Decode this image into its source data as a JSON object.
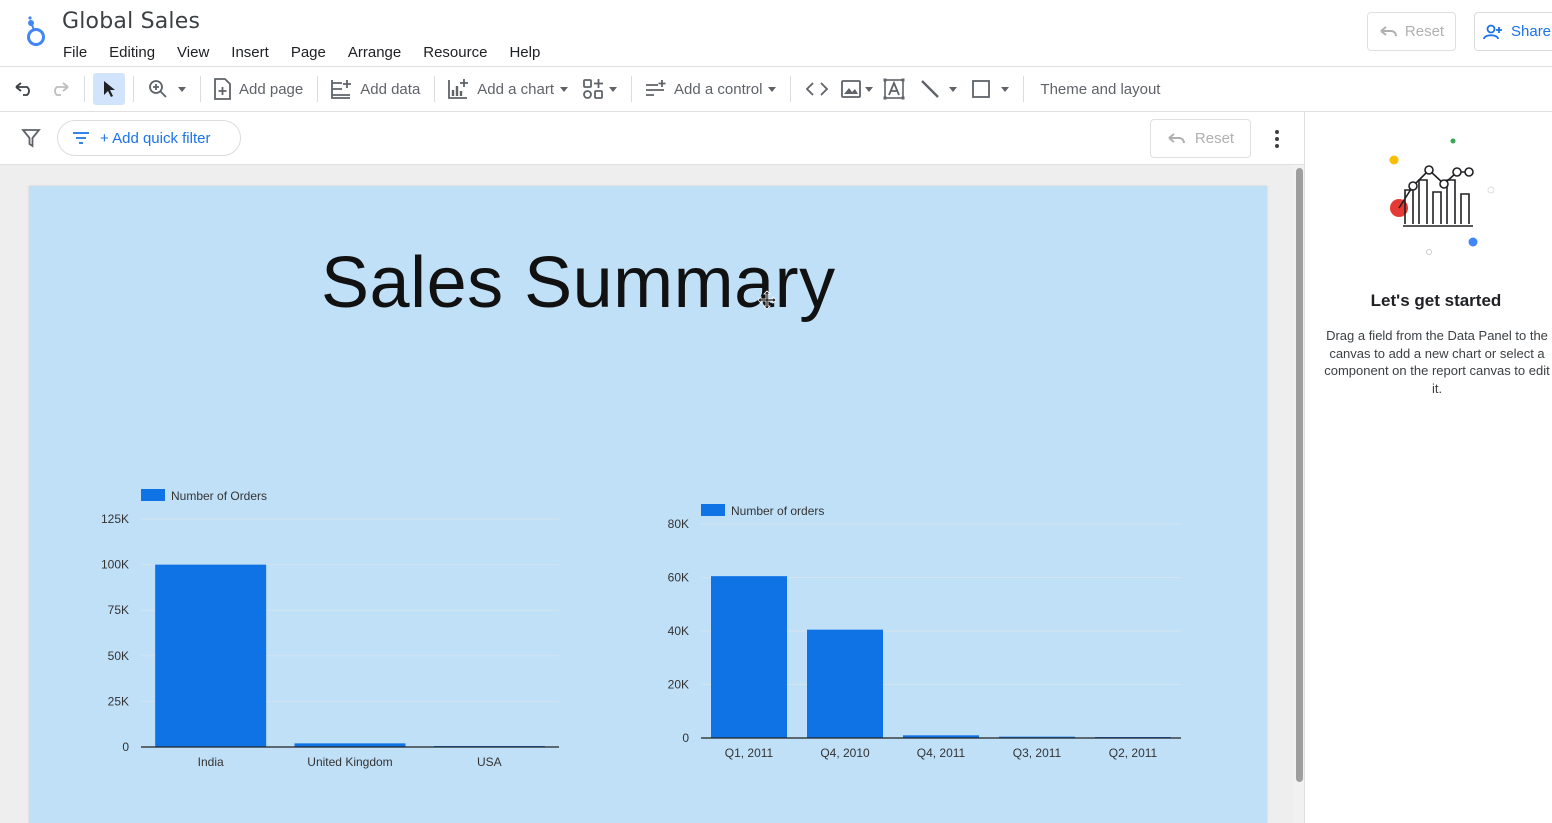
{
  "app": {
    "title": "Global Sales",
    "menu": [
      "File",
      "Editing",
      "View",
      "Insert",
      "Page",
      "Arrange",
      "Resource",
      "Help"
    ],
    "reset_label": "Reset",
    "share_label": "Share"
  },
  "toolbar": {
    "add_page": "Add page",
    "add_data": "Add data",
    "add_chart": "Add a chart",
    "add_control": "Add a control",
    "theme_layout": "Theme and layout"
  },
  "filterbar": {
    "quick_filter": "+ Add quick filter",
    "reset_label": "Reset"
  },
  "report": {
    "title": "Sales Summary"
  },
  "chart_data": [
    {
      "type": "bar",
      "legend": "Number of Orders",
      "categories": [
        "India",
        "United Kingdom",
        "USA"
      ],
      "values": [
        100000,
        2000,
        300
      ],
      "yticks": [
        "0",
        "25K",
        "50K",
        "75K",
        "100K",
        "125K"
      ],
      "ylim": [
        0,
        125000
      ],
      "color": "#0f73e6"
    },
    {
      "type": "bar",
      "legend": "Number of orders",
      "categories": [
        "Q1, 2011",
        "Q4, 2010",
        "Q4, 2011",
        "Q3, 2011",
        "Q2, 2011"
      ],
      "values": [
        60500,
        40500,
        1000,
        500,
        300
      ],
      "yticks": [
        "0",
        "20K",
        "40K",
        "60K",
        "80K"
      ],
      "ylim": [
        0,
        80000
      ],
      "color": "#0f73e6"
    }
  ],
  "right_panel": {
    "title": "Let's get started",
    "description": "Drag a field from the Data Panel to the canvas to add a new chart or select a component on the report canvas to edit it."
  }
}
